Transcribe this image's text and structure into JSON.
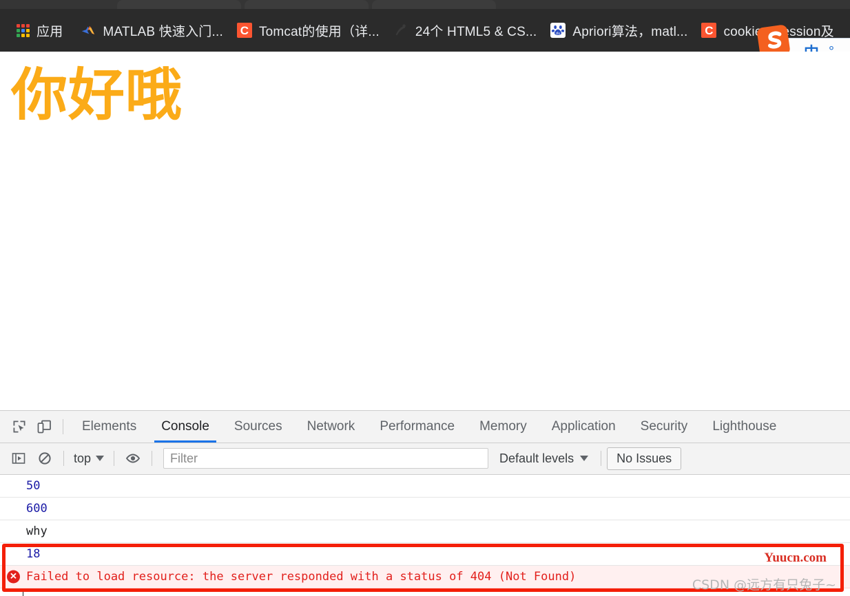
{
  "browser": {
    "bookmarks": [
      {
        "label": "应用",
        "icon": "apps-grid-icon",
        "favicon_type": "grid"
      },
      {
        "label": "MATLAB 快速入门...",
        "icon": "matlab-icon",
        "favicon_type": "matlab"
      },
      {
        "label": "Tomcat的使用（详...",
        "icon": "csdn-icon",
        "favicon_type": "letter",
        "letter": "C",
        "color": "#fc5531"
      },
      {
        "label": "24个 HTML5 & CS...",
        "icon": "page-icon",
        "favicon_type": "ghost"
      },
      {
        "label": "Apriori算法，matl...",
        "icon": "baidu-icon",
        "favicon_type": "baidu"
      },
      {
        "label": "cookie、session及",
        "icon": "csdn-icon",
        "favicon_type": "letter",
        "letter": "C",
        "color": "#fc5531"
      }
    ],
    "ime": {
      "logo_name": "sogou-ime-logo",
      "mode_label": "中",
      "symbol_label": "°,"
    }
  },
  "page": {
    "heading": "你好哦",
    "heading_color": "#fbab18"
  },
  "devtools": {
    "toolbar_icons": [
      {
        "name": "inspect-element-icon"
      },
      {
        "name": "device-toolbar-icon"
      }
    ],
    "tabs": [
      {
        "label": "Elements",
        "active": false
      },
      {
        "label": "Console",
        "active": true
      },
      {
        "label": "Sources",
        "active": false
      },
      {
        "label": "Network",
        "active": false
      },
      {
        "label": "Performance",
        "active": false
      },
      {
        "label": "Memory",
        "active": false
      },
      {
        "label": "Application",
        "active": false
      },
      {
        "label": "Security",
        "active": false
      },
      {
        "label": "Lighthouse",
        "active": false
      }
    ],
    "filterbar": {
      "sidebar_toggle_icon": "console-sidebar-icon",
      "clear_icon": "clear-console-icon",
      "context_label": "top",
      "eye_icon": "live-expression-icon",
      "filter_value": "",
      "filter_placeholder": "Filter",
      "levels_label": "Default levels",
      "issues_label": "No Issues"
    },
    "console_messages": [
      {
        "text": "50",
        "type": "number"
      },
      {
        "text": "600",
        "type": "number"
      },
      {
        "text": "why",
        "type": "text"
      },
      {
        "text": "18",
        "type": "number"
      },
      {
        "text": "Failed to load resource: the server responded with a status of 404 (Not Found)",
        "type": "error",
        "icon": "error-circle-icon"
      }
    ]
  },
  "annotation": {
    "box_color": "#f41f07",
    "box_name": "red-highlight-box"
  },
  "watermarks": {
    "yuucn": "Yuucn.com",
    "csdn": "CSDN @远方有只兔子~"
  }
}
